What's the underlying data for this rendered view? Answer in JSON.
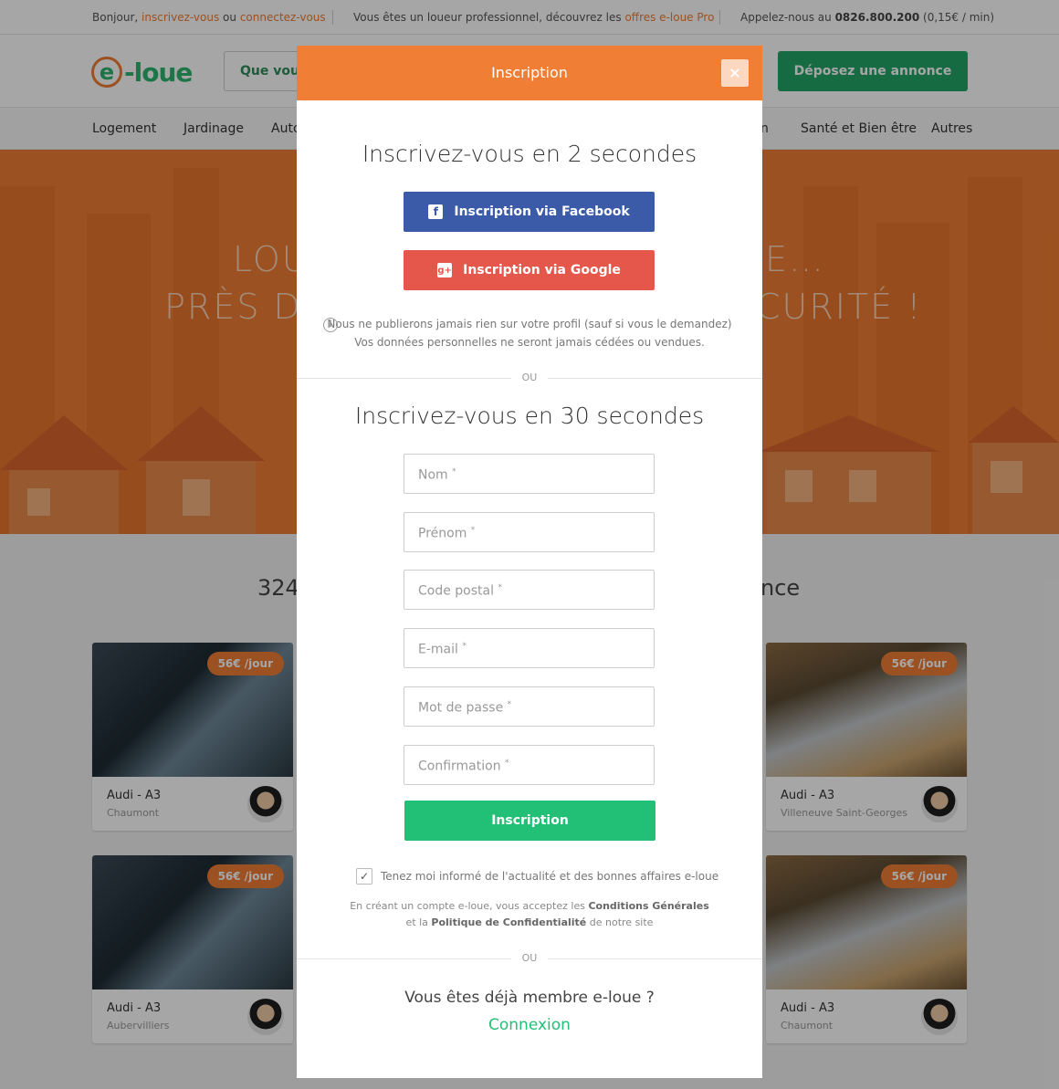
{
  "topbar": {
    "greeting": "Bonjour,",
    "signup_link": "inscrivez-vous",
    "or": "ou",
    "login_link": "connectez-vous",
    "pro_text": "Vous êtes un loueur professionnel, découvrez les",
    "pro_link": "offres e-loue Pro",
    "phone_text": "Appelez-nous au",
    "phone_number": "0826.800.200",
    "phone_rate": "(0,15€ / min)"
  },
  "header": {
    "logo_e": "e",
    "logo_rest": "-loue",
    "search_placeholder": "Que voulez-vous louer ?",
    "deposit_label": "Déposez une annonce"
  },
  "categories": [
    "Logement",
    "Jardinage",
    "Auto",
    "n",
    "Santé et Bien être",
    "Autres"
  ],
  "hero": {
    "line1_left": "LOU",
    "line1_right": "E…",
    "line2_left": "PRÈS DE",
    "line2_right": "CURITÉ !"
  },
  "listing": {
    "count_left": "324",
    "count_right": "nce",
    "cards": [
      {
        "price": "56€ /jour",
        "title": "Audi - A3",
        "city": "Chaumont",
        "kind": "bike"
      },
      {
        "price": "56€ /jour",
        "title": "Audi - A3",
        "city": "Villeneuve Saint-Georges",
        "kind": "car"
      },
      {
        "price": "56€ /jour",
        "title": "Audi - A3",
        "city": "Aubervilliers",
        "kind": "bike"
      },
      {
        "price": "56€ /jour",
        "title": "Audi - A3",
        "city": "Chaumont",
        "kind": "car"
      }
    ]
  },
  "modal": {
    "title": "Inscription",
    "close_label": "×",
    "fast_heading": "Inscrivez-vous en 2 secondes",
    "facebook_label": "Inscription via Facebook",
    "google_label": "Inscription via Google",
    "privacy_line1": "Nous ne publierons jamais rien sur votre profil (sauf si vous le demandez)",
    "privacy_line2": "Vos données personnelles ne seront jamais cédées ou vendues.",
    "or_label": "OU",
    "slow_heading": "Inscrivez-vous en 30 secondes",
    "fields": {
      "nom": "Nom",
      "prenom": "Prénom",
      "code_postal": "Code postal",
      "email": "E-mail",
      "password": "Mot de passe",
      "confirmation": "Confirmation"
    },
    "required_mark": "*",
    "submit_label": "Inscription",
    "newsletter_checked": true,
    "newsletter_label": "Tenez moi informé de l'actualité et des bonnes affaires e-loue",
    "terms_part1": "En créant un compte e-loue, vous acceptez les",
    "terms_link1": "Conditions Générales",
    "terms_part2": "et la",
    "terms_link2": "Politique de Confidentialité",
    "terms_part3": "de notre site",
    "member_question": "Vous êtes déjà membre e-loue ?",
    "login_label": "Connexion"
  },
  "colors": {
    "brand_orange": "#f07f35",
    "brand_green": "#22bf76",
    "facebook_blue": "#3b5ba8",
    "google_red": "#e4574a"
  }
}
